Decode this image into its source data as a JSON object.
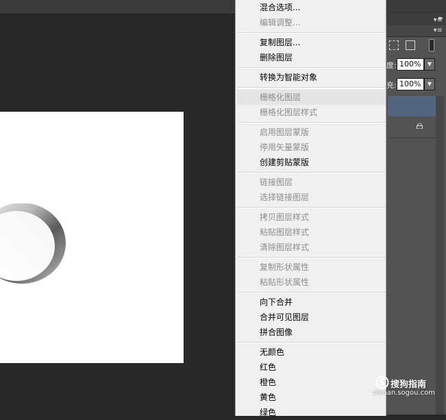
{
  "panel": {
    "opacity_label": "度:",
    "opacity_value": "100%",
    "fill_label": "充:",
    "fill_value": "100%"
  },
  "context_menu": {
    "items": [
      {
        "label": "混合选项...",
        "enabled": true
      },
      {
        "label": "编辑调整...",
        "enabled": false
      },
      {
        "label": "复制图层...",
        "enabled": true
      },
      {
        "label": "删除图层",
        "enabled": true
      },
      {
        "label": "转换为智能对象",
        "enabled": true
      },
      {
        "label": "栅格化图层",
        "enabled": false,
        "highlighted": true
      },
      {
        "label": "栅格化图层样式",
        "enabled": false
      },
      {
        "label": "启用图层蒙版",
        "enabled": false
      },
      {
        "label": "停用矢量蒙版",
        "enabled": false
      },
      {
        "label": "创建剪贴蒙版",
        "enabled": true
      },
      {
        "label": "链接图层",
        "enabled": false
      },
      {
        "label": "选择链接图层",
        "enabled": false
      },
      {
        "label": "拷贝图层样式",
        "enabled": false
      },
      {
        "label": "粘贴图层样式",
        "enabled": false
      },
      {
        "label": "清除图层样式",
        "enabled": false
      },
      {
        "label": "复制形状属性",
        "enabled": false
      },
      {
        "label": "粘贴形状属性",
        "enabled": false
      },
      {
        "label": "向下合并",
        "enabled": true
      },
      {
        "label": "合并可见图层",
        "enabled": true
      },
      {
        "label": "拼合图像",
        "enabled": true
      },
      {
        "label": "无颜色",
        "enabled": true
      },
      {
        "label": "红色",
        "enabled": true
      },
      {
        "label": "橙色",
        "enabled": true
      },
      {
        "label": "黄色",
        "enabled": true
      },
      {
        "label": "绿色",
        "enabled": true
      }
    ]
  },
  "watermark": {
    "title": "搜狗指南",
    "url": "zhinan.sogou.com"
  },
  "colors": {
    "workspace": "#282828",
    "panel": "#535353",
    "selected_layer": "#52657e",
    "menu_bg": "#f0f0f0",
    "menu_disabled_text": "#8d8d8d"
  }
}
